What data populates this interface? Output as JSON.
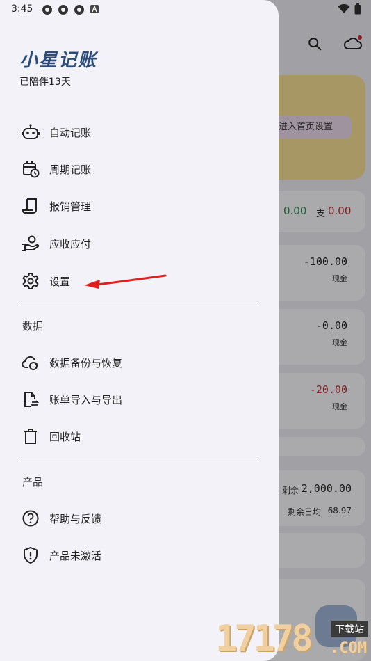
{
  "status": {
    "time": "3:45"
  },
  "drawer": {
    "title": "小星记账",
    "subtitle": "已陪伴13天",
    "items_top": [
      {
        "label": "自动记账",
        "icon": "robot-icon"
      },
      {
        "label": "周期记账",
        "icon": "calendar-clock-icon"
      },
      {
        "label": "报销管理",
        "icon": "receipt-icon"
      },
      {
        "label": "应收应付",
        "icon": "hand-coin-icon"
      },
      {
        "label": "设置",
        "icon": "gear-icon"
      }
    ],
    "section_data": "数据",
    "items_data": [
      {
        "label": "数据备份与恢复",
        "icon": "cloud-sync-icon"
      },
      {
        "label": "账单导入与导出",
        "icon": "file-transfer-icon"
      },
      {
        "label": "回收站",
        "icon": "trash-icon"
      }
    ],
    "section_product": "产品",
    "items_product": [
      {
        "label": "帮助与反馈",
        "icon": "help-circle-icon"
      },
      {
        "label": "产品未激活",
        "icon": "shield-alert-icon"
      }
    ]
  },
  "background": {
    "banner_chip": "可进入首页设置",
    "income_label": "",
    "income_value": "0.00",
    "expense_label": "支",
    "expense_value": "0.00",
    "records": [
      {
        "amount": "-100.00",
        "account": "现金",
        "color": "#222222"
      },
      {
        "amount": "-0.00",
        "account": "现金",
        "color": "#222222"
      },
      {
        "amount": "-20.00",
        "account": "现金",
        "color": "#c0303a"
      }
    ],
    "budget_label": "剩余",
    "budget_value": "2,000.00",
    "daily_label": "剩余日均",
    "daily_value": "68.97"
  },
  "watermark": {
    "digits": "17178",
    "tag": "下载站",
    "domain": ".COM"
  },
  "colors": {
    "accent": "#2c4d7a",
    "income": "#2e8b57",
    "expense": "#c0303a",
    "arrow": "#e02020"
  }
}
